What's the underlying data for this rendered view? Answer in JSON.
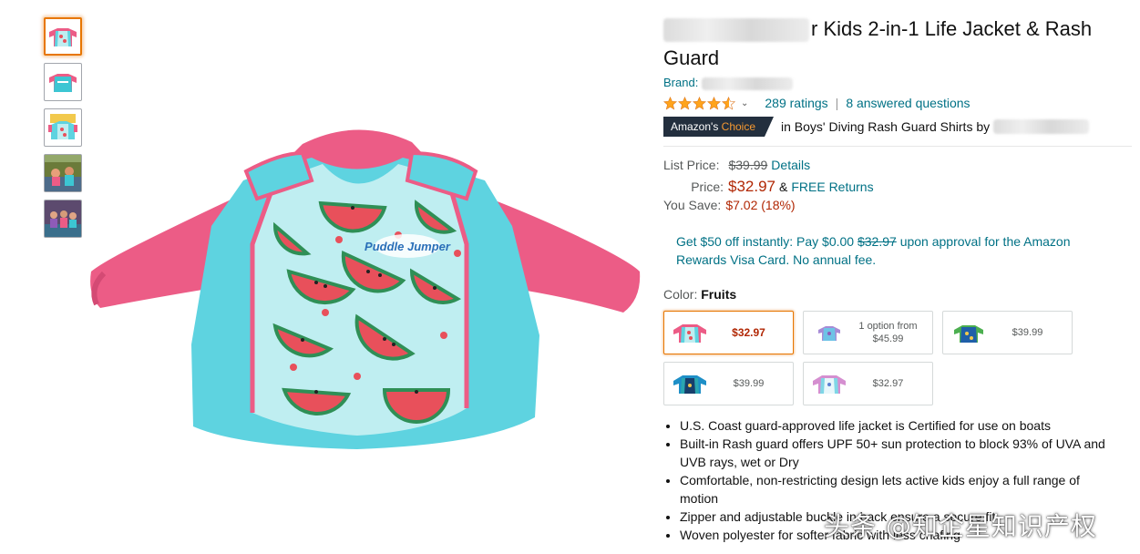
{
  "product": {
    "title_visible": "r Kids 2-in-1 Life Jacket & Rash Guard",
    "brand_label": "Brand:",
    "rating_stars": 4.5,
    "ratings_text": "289 ratings",
    "answered_text": "8 answered questions",
    "separator": "|",
    "badge_word1": "Amazon's",
    "badge_word2": "Choice",
    "badge_context": "in Boys' Diving Rash Guard Shirts by"
  },
  "pricing": {
    "list_price_label": "List Price:",
    "list_price_value": "$39.99",
    "details_link": "Details",
    "price_label": "Price:",
    "price_value": "$32.97",
    "ampersand": "&",
    "free_returns": "FREE Returns",
    "you_save_label": "You Save:",
    "you_save_value": "$7.02 (18%)"
  },
  "offer": {
    "text_before": "Get $50 off instantly: Pay $0.00",
    "strike_price": "$32.97",
    "text_after": "upon approval for the Amazon Rewards Visa Card. No annual fee."
  },
  "color": {
    "label": "Color:",
    "selected": "Fruits",
    "swatches": [
      {
        "price": "$32.97",
        "variant": "fruits"
      },
      {
        "price": "1 option from $45.99",
        "variant": "purple"
      },
      {
        "price": "$39.99",
        "variant": "blue-green"
      },
      {
        "price": "$39.99",
        "variant": "teal"
      },
      {
        "price": "$32.97",
        "variant": "light"
      }
    ]
  },
  "bullets": [
    "U.S. Coast guard-approved life jacket is Certified for use on boats",
    "Built-in Rash guard offers UPF 50+ sun protection to block 93% of UVA and UVB rays, wet or Dry",
    "Comfortable, non-restricting design lets active kids enjoy a full range of motion",
    "Zipper and adjustable buckle in back ensure a secure fit",
    "Woven polyester for softer fabric with less chafing"
  ],
  "thumbnails": [
    "thumb-front",
    "thumb-back",
    "thumb-detail",
    "thumb-lifestyle-1",
    "thumb-lifestyle-2"
  ],
  "main_image_logo_text": "Puddle Jumper",
  "watermark": "头条 @知企星知识产权",
  "colors": {
    "link": "#007185",
    "price": "#b12704",
    "selected_border": "#e77600",
    "badge_bg": "#232f3e",
    "badge_orange": "#f69931",
    "star": "#ffa41c",
    "sleeve_pink": "#ec5c86",
    "vest_aqua": "#5ed3e0",
    "panel_light": "#bfeef1",
    "watermelon": "#e8505b"
  }
}
